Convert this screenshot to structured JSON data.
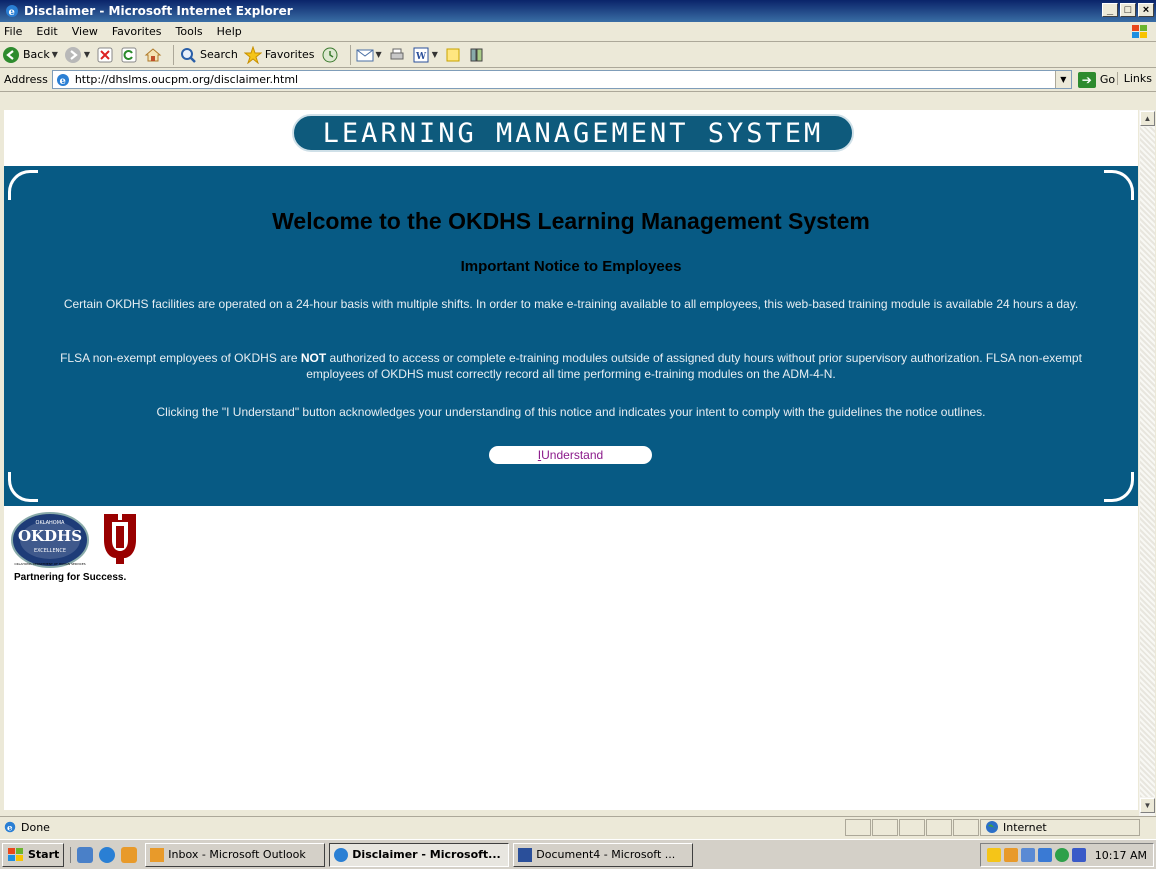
{
  "window": {
    "title": "Disclaimer - Microsoft Internet Explorer",
    "controls": [
      "_",
      "□",
      "×"
    ]
  },
  "menu": {
    "items": [
      "File",
      "Edit",
      "View",
      "Favorites",
      "Tools",
      "Help"
    ]
  },
  "toolbar": {
    "back_label": "Back",
    "search_label": "Search",
    "favorites_label": "Favorites"
  },
  "address": {
    "label": "Address",
    "url": "http://dhslms.oucpm.org/disclaimer.html",
    "go_label": "Go",
    "links_label": "Links"
  },
  "page": {
    "banner": "LEARNING MANAGEMENT SYSTEM",
    "welcome": "Welcome to the OKDHS Learning Management System",
    "notice_title": "Important Notice to Employees",
    "para1": "Certain OKDHS facilities are operated on a 24-hour basis with multiple shifts. In order to make e-training available to all employees, this web-based training module is available 24 hours a day.",
    "para2_before": "FLSA non-exempt employees of OKDHS are ",
    "para2_bold": "NOT",
    "para2_after": " authorized to access or complete e-training modules outside of assigned duty hours without prior supervisory authorization. FLSA non-exempt employees of OKDHS must correctly record all time performing e-training modules on the ADM-4-N.",
    "para3": "Clicking the \"I Understand\" button acknowledges your understanding of this notice and indicates your intent to comply with the guidelines the notice outlines.",
    "button_accesskey": "I",
    "button_rest": " Understand",
    "seal_text_top": "OKLAHOMA",
    "seal_text_main": "OKDHS",
    "seal_text_sub": "EXCELLENCE",
    "seal_text_bottom": "OKLAHOMA DEPARTMENT OF HUMAN SERVICES",
    "partner_text": "Partnering for Success."
  },
  "status": {
    "text": "Done",
    "zone": "Internet"
  },
  "taskbar": {
    "start": "Start",
    "tasks": [
      {
        "label": "Inbox - Microsoft Outlook",
        "active": false
      },
      {
        "label": "Disclaimer - Microsoft...",
        "active": true
      },
      {
        "label": "Document4 - Microsoft ...",
        "active": false
      }
    ],
    "clock": "10:17 AM"
  },
  "colors": {
    "panel": "#075A84",
    "banner": "#0E5A7C",
    "button_text": "#8B1A8B"
  }
}
